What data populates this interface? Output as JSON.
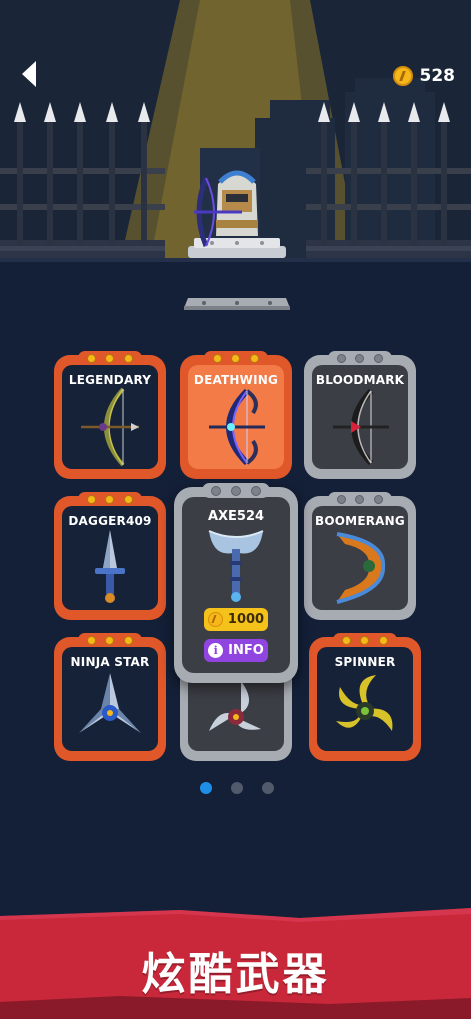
{
  "header": {
    "back_icon": "back-arrow-icon",
    "coins": "528",
    "coin_icon": "coin-icon"
  },
  "weapons": [
    {
      "name": "LEGENDARY",
      "state": "owned",
      "icon": "bow-icon"
    },
    {
      "name": "DEATHWING",
      "state": "selected",
      "icon": "bow-icon"
    },
    {
      "name": "BLOODMARK",
      "state": "locked",
      "icon": "bow-icon"
    },
    {
      "name": "DAGGER409",
      "state": "owned",
      "icon": "dagger-icon"
    },
    {
      "name": "AXE524",
      "state": "locked",
      "icon": "axe-icon",
      "price": "1000"
    },
    {
      "name": "BOOMERANG",
      "state": "locked",
      "icon": "boomerang-icon"
    },
    {
      "name": "NINJA STAR",
      "state": "owned",
      "icon": "shuriken-icon"
    },
    {
      "name": "",
      "state": "locked",
      "icon": "shuriken-icon"
    },
    {
      "name": "SPINNER",
      "state": "owned",
      "icon": "spinner-icon"
    }
  ],
  "popup": {
    "name": "AXE524",
    "price": "1000",
    "info_label": "INFO"
  },
  "pagination": {
    "pages": 3,
    "current": 1
  },
  "banner": {
    "text": "炫酷武器"
  },
  "colors": {
    "background": "#142038",
    "card_orange": "#e0572a",
    "card_selected_fill": "#f27b48",
    "card_grey": "#a7abb2",
    "coin": "#f5b719",
    "info_button": "#9145e0",
    "pagination_active": "#1e8ee6",
    "banner_red": "#c8283a"
  }
}
